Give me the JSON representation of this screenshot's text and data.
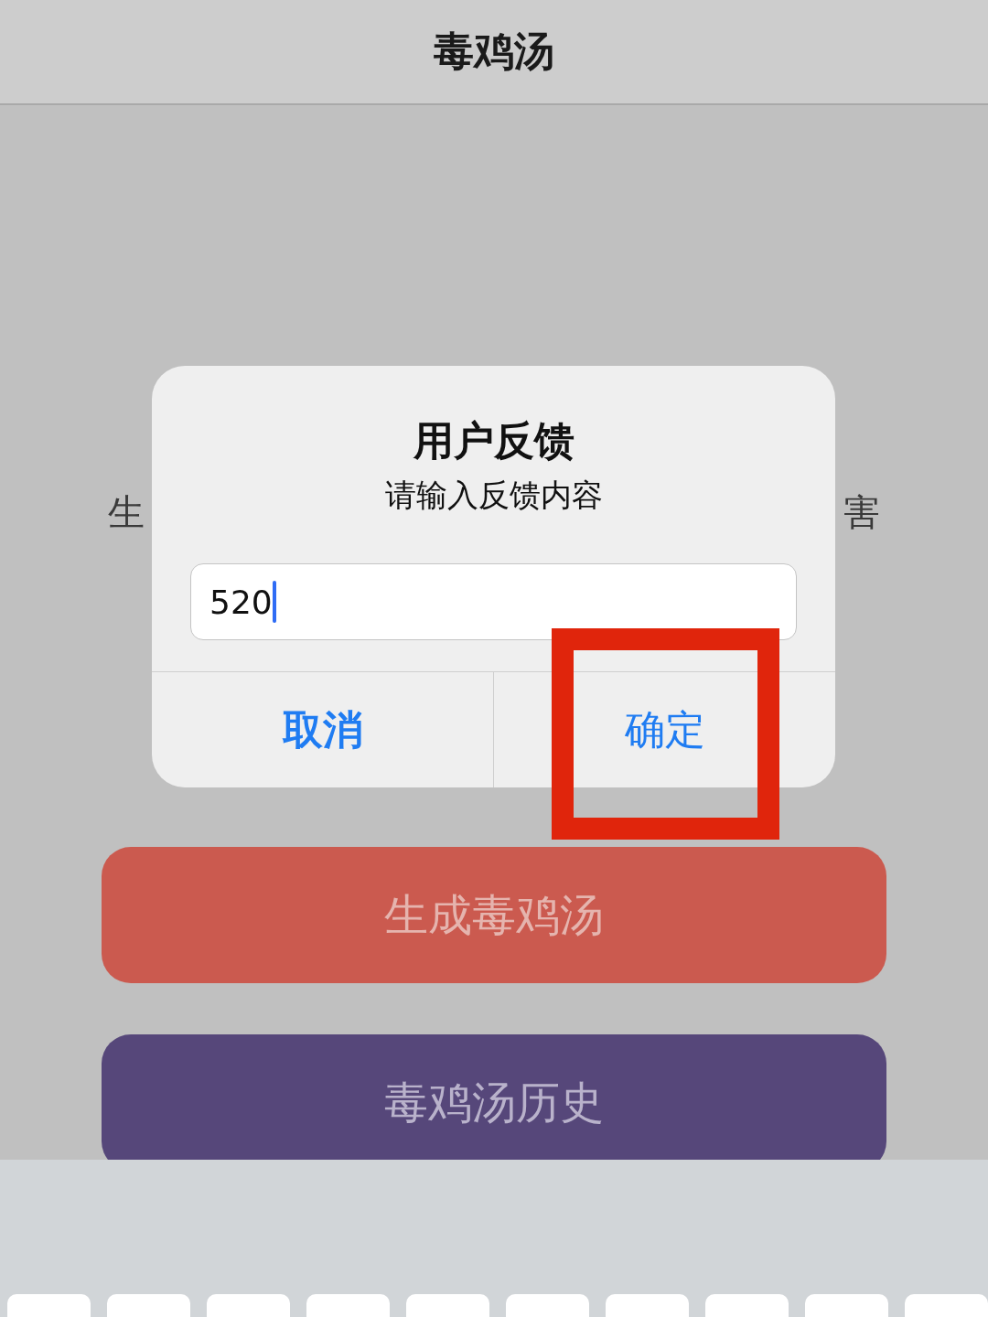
{
  "nav_bar": {
    "title": "毒鸡汤"
  },
  "background_text": [
    "生",
    "害"
  ],
  "dialog": {
    "title": "用户反馈",
    "message": "请输入反馈内容",
    "input": {
      "value": "520",
      "focused": true
    },
    "buttons": [
      {
        "label": "取消",
        "kind": "cancel"
      },
      {
        "label": "确定",
        "kind": "default"
      }
    ]
  },
  "actions": [
    {
      "label": "生成毒鸡汤",
      "color": "#cb5a4f"
    },
    {
      "label": "毒鸡汤历史",
      "color": "#56477a"
    }
  ]
}
